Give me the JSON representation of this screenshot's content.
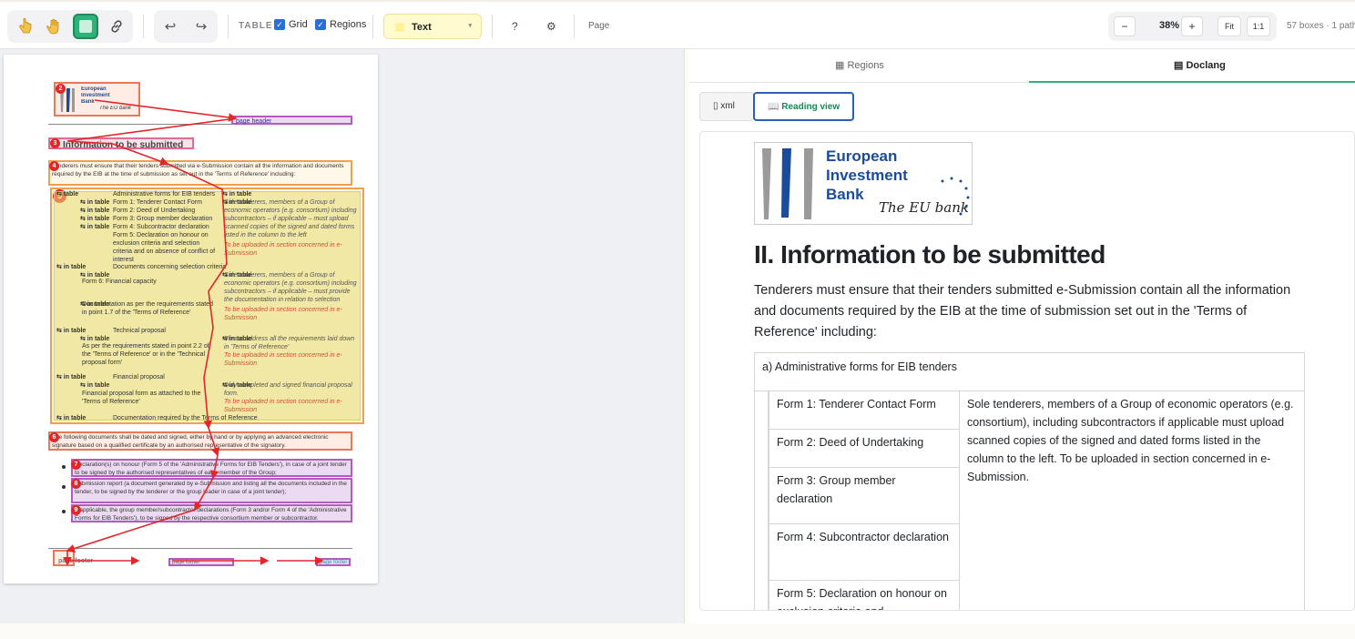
{
  "toolbar": {
    "table_label": "TABLE",
    "grid_label": "Grid",
    "regions_label": "Regions",
    "text_selector": "Text",
    "help_label": "?",
    "page_label": "Page",
    "zoom_minus": "−",
    "zoom_value": "38%",
    "zoom_plus": "+",
    "fit_label": "Fit",
    "one_to_one_label": "1:1",
    "box_count": "57 boxes · 1 path"
  },
  "right_tabs": {
    "regions": "Regions",
    "doclang": "Doclang"
  },
  "sub_tabs": {
    "xml": "xml",
    "reading_view": "Reading view"
  },
  "document": {
    "logo_line1": "European",
    "logo_line2": "Investment",
    "logo_line3": "Bank",
    "logo_tag": "The EU bank",
    "heading": "II. Information to be submitted",
    "paragraph": "Tenderers must ensure that their tenders submitted e-Submission contain all the information and documents required by the EIB at the time of submission set out in the 'Terms of Reference' including:",
    "table_header": "a) Administrative forms for EIB tenders",
    "forms": [
      "Form 1: Tenderer Contact Form",
      "Form 2: Deed of Undertaking",
      "Form 3: Group member declaration",
      "Form 4: Subcontractor declaration",
      "Form 5: Declaration on honour on exclusion criteria and"
    ],
    "right_cell": "Sole tenderers, members of a Group of economic operators (e.g. consortium), including subcontractors if applicable must upload scanned copies of the signed and dated forms listed in the column to the left. To be uploaded in section concerned in e- Submission."
  },
  "mini_page": {
    "logo_line1": "European",
    "logo_line2": "Investment",
    "logo_line3": "Bank",
    "logo_tag": "The EU bank",
    "page_header_tag": "page header",
    "section_title": "Information to be submitted",
    "intro": "Tenderers must ensure that their tenders submitted via e-Submission contain all the information and documents required by the EIB at the time of submission as set out in the 'Terms of Reference' including:",
    "in_table": "in table",
    "rows_left": [
      "Administrative forms for EIB tenders",
      "Form 1: Tenderer Contact Form",
      "Form 2: Deed of Undertaking",
      "Form 3: Group member declaration",
      "Form 4: Subcontractor declaration",
      "Form 5: Declaration on honour on exclusion criteria and selection criteria and on absence of conflict of interest",
      "Documents concerning selection criteria",
      "Form 6: Financial capacity",
      "Documentation as per the requirements stated in point 1.7 of the 'Terms of Reference'",
      "Technical proposal",
      "As per the requirements stated in point 2.2 of the 'Terms of Reference' or in the 'Technical proposal form'",
      "Financial proposal",
      "Financial proposal form as attached to the 'Terms of Reference'",
      "Documentation required by the Terms of Reference"
    ],
    "rows_right": [
      "Sole tenderers, members of a Group of economic operators (e.g. consortium) including subcontractors – if applicable – must upload scanned copies of the signed and dated forms listed in the column to the left",
      "To be uploaded in section concerned in e-Submission",
      "Sole tenderers, members of a Group of economic operators (e.g. consortium) including subcontractors – if applicable – must provide the documentation in relation to selection criteria",
      "To be uploaded in section concerned in e-Submission",
      "Please address all the requirements laid down in 'Terms of Reference'",
      "To be uploaded in section concerned in e-Submission",
      "Duly completed and signed financial proposal form.",
      "To be uploaded in section concerned in e-Submission"
    ],
    "signed_para": "The following documents shall be dated and signed, either by hand or by applying an advanced electronic signature based on a qualified certificate by an authorised representative of the signatory.",
    "bullet1": "Declaration(s) on honour (Form 5 of the 'Administrative Forms for EIB Tenders'), in case of a joint tender to be signed by the authorised representatives of each member of the Group;",
    "bullet2": "Submission report (a document generated by e-Submission and listing all the documents included in the tender, to be signed by the tenderer or the group leader in case of a joint tender);",
    "bullet3": "If applicable, the group member/subcontractor declarations (Form 3 and/or Form 4 of the 'Administrative Forms for EIB Tenders'), to be signed by the respective consortium member or subcontractor.",
    "footer_left": "page footer",
    "footer_mid": "page footer",
    "footer_right": "page footer"
  },
  "colors": {
    "accent_green": "#2fb27a",
    "active_blue": "#2a5fb3",
    "region_red": "#e9785a",
    "region_yellow": "#e0d24a",
    "region_purple": "#b45bc0",
    "arrow_red": "#e2272b",
    "eib_blue": "#1b4c9c"
  }
}
